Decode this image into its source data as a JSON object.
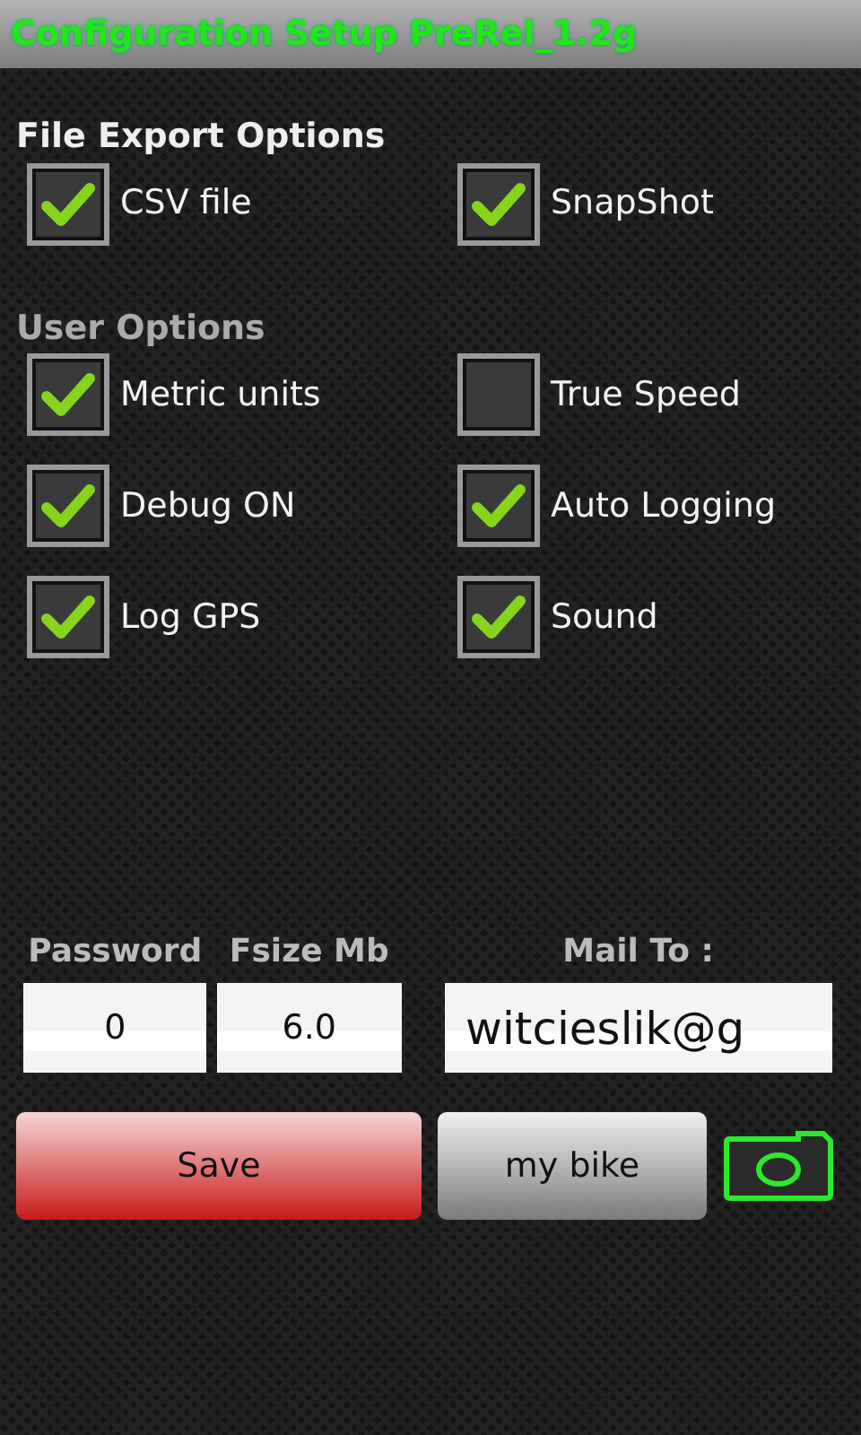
{
  "window": {
    "title": "Configuration Setup PreRel_1.2g"
  },
  "sections": [
    {
      "title": "File Export Options",
      "options": [
        {
          "label": "CSV file",
          "checked": true
        },
        {
          "label": "SnapShot",
          "checked": true
        }
      ]
    },
    {
      "title": "User Options",
      "options": [
        {
          "label": "Metric units",
          "checked": true
        },
        {
          "label": "True Speed",
          "checked": false
        },
        {
          "label": "Debug ON",
          "checked": true
        },
        {
          "label": "Auto Logging",
          "checked": true
        },
        {
          "label": "Log GPS",
          "checked": true
        },
        {
          "label": "Sound",
          "checked": true
        }
      ]
    }
  ],
  "fields": [
    {
      "label": "Password",
      "value": "0"
    },
    {
      "label": "Fsize Mb",
      "value": "6.0"
    },
    {
      "label": "Mail To :",
      "value": "witcieslik@g"
    }
  ],
  "buttons": [
    {
      "label": "Save",
      "kind": "primary"
    },
    {
      "label": "my bike",
      "kind": "secondary"
    }
  ]
}
